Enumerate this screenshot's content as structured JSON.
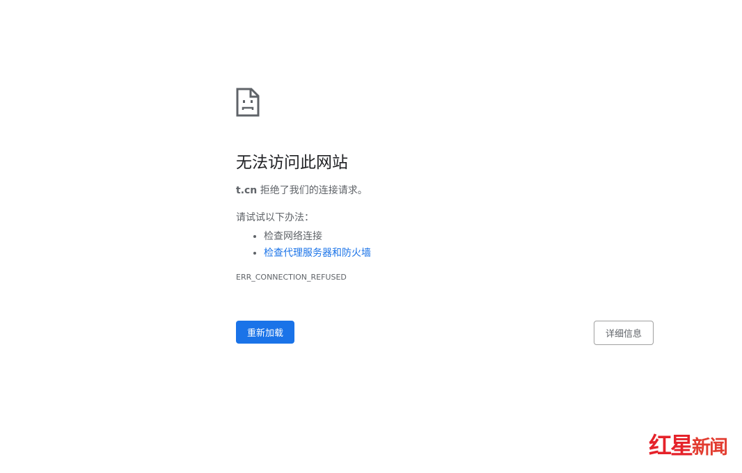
{
  "icon": "sad-page-icon",
  "title": "无法访问此网站",
  "description": {
    "host": "t.cn",
    "message": "拒绝了我们的连接请求。"
  },
  "suggestions": {
    "heading": "请试试以下办法：",
    "items": [
      {
        "label": "检查网络连接",
        "link": false
      },
      {
        "label": "检查代理服务器和防火墙",
        "link": true
      }
    ]
  },
  "error_code": "ERR_CONNECTION_REFUSED",
  "buttons": {
    "reload": "重新加载",
    "details": "详细信息"
  },
  "colors": {
    "accent": "#1a73e8",
    "text": "#5f6368",
    "logo": "#e5222a"
  },
  "watermark": {
    "part1": "红星",
    "part2": "新闻"
  }
}
